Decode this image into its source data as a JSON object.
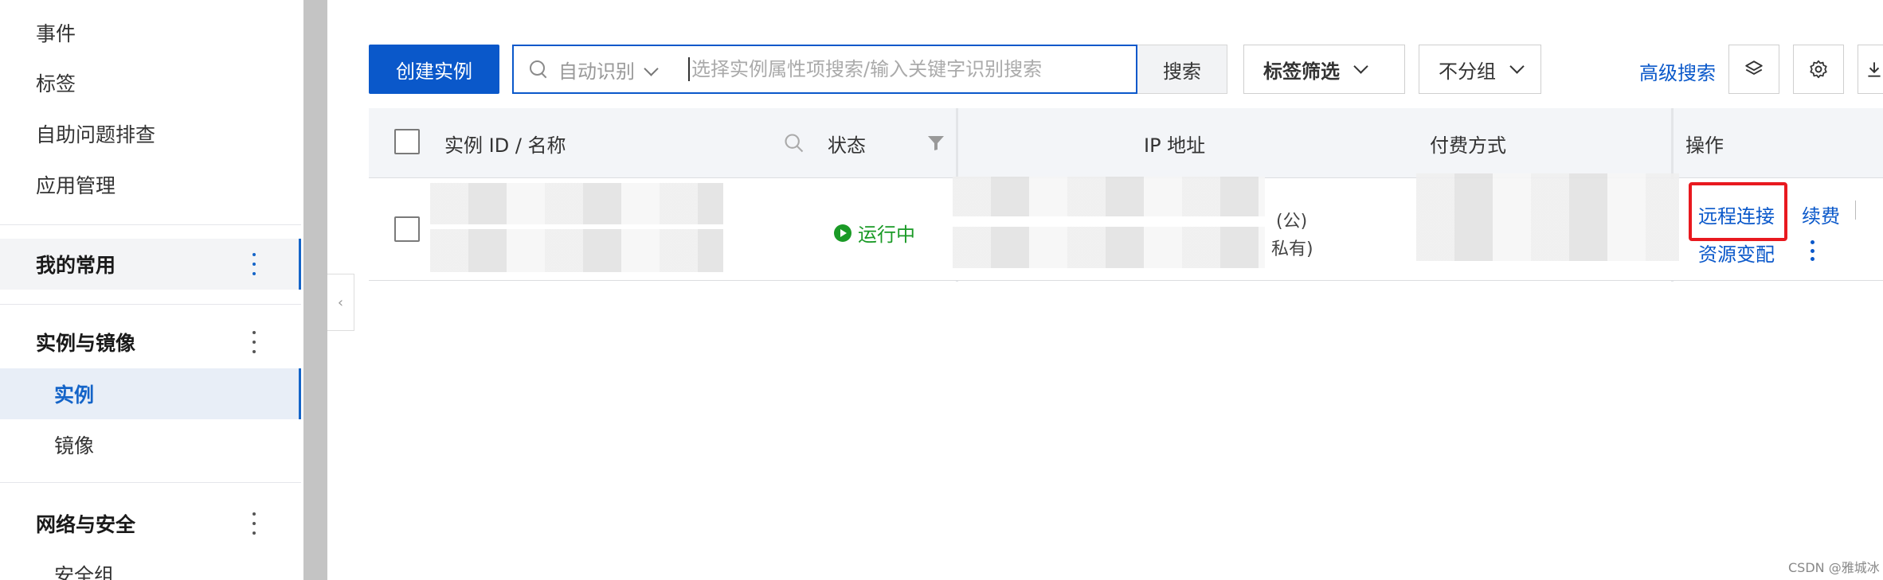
{
  "sidebar": {
    "items": [
      {
        "label": "事件"
      },
      {
        "label": "标签"
      },
      {
        "label": "自助问题排查"
      },
      {
        "label": "应用管理"
      }
    ],
    "groups": [
      {
        "label": "我的常用"
      },
      {
        "label": "实例与镜像",
        "children": [
          {
            "label": "实例"
          },
          {
            "label": "镜像"
          }
        ]
      },
      {
        "label": "网络与安全",
        "children": [
          {
            "label": "安全组"
          }
        ]
      }
    ]
  },
  "toolbar": {
    "create_label": "创建实例",
    "search_mode": "自动识别",
    "search_placeholder": "选择实例属性项搜索/输入关键字识别搜索",
    "search_label": "搜索",
    "tag_filter_label": "标签筛选",
    "group_label": "不分组",
    "advanced_search_label": "高级搜索",
    "icons": [
      "layers-icon",
      "gear-icon",
      "download-icon"
    ]
  },
  "table": {
    "columns": [
      "实例 ID / 名称",
      "状态",
      "IP 地址",
      "付费方式",
      "操作"
    ],
    "rows": [
      {
        "status": "运行中",
        "ip_public_suffix": "(公)",
        "ip_private_suffix": "私有)",
        "actions": [
          "远程连接",
          "续费",
          "资源变配"
        ]
      }
    ]
  },
  "colors": {
    "accent": "#0a58ca",
    "running": "#1a9a26",
    "highlight": "#e8191f"
  },
  "watermark": "CSDN @雅城冰"
}
